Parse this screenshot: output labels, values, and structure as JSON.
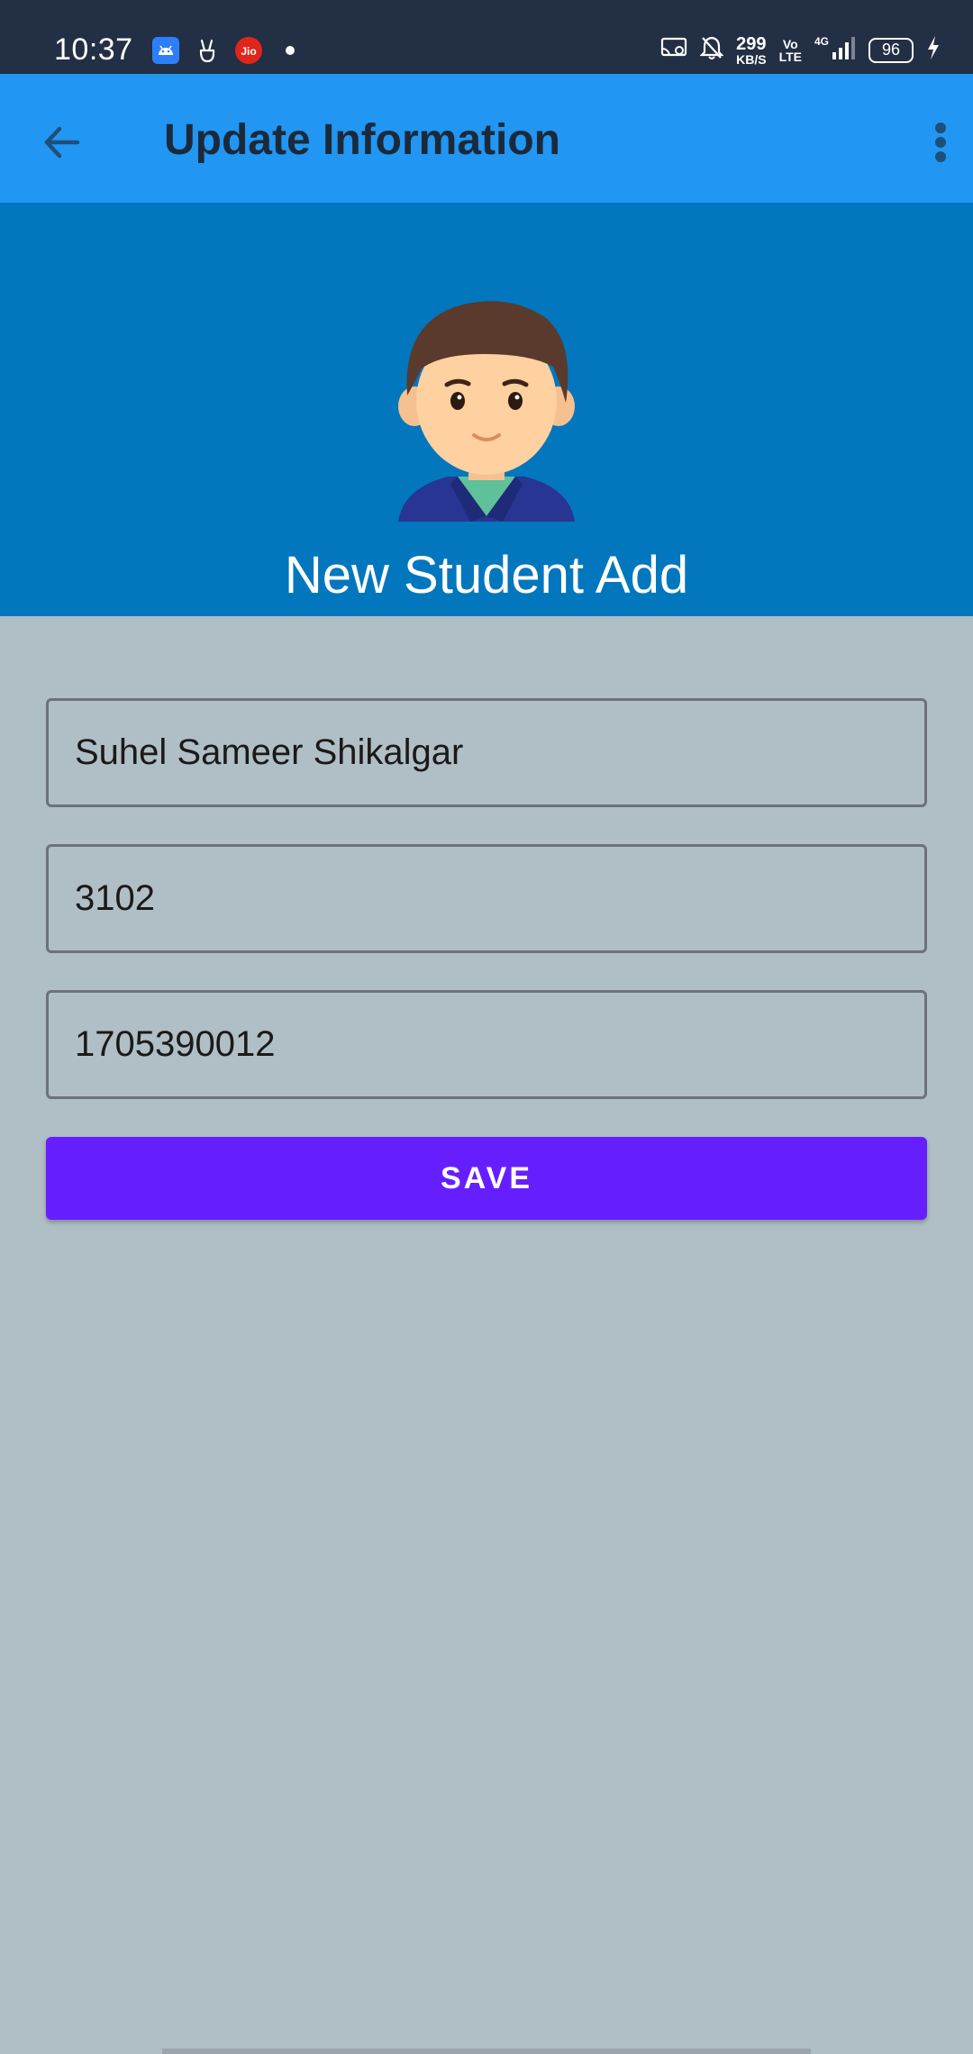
{
  "status_bar": {
    "time": "10:37",
    "notification_icons": [
      "android-icon",
      "peace-hand-icon",
      "jio-icon",
      "dot-icon"
    ],
    "jio_label": "Jio",
    "net_speed_value": "299",
    "net_speed_unit": "KB/S",
    "volte_top": "Vo",
    "volte_bottom": "LTE",
    "network_type": "4G",
    "battery_level": "96",
    "colors": {
      "background": "#232f45",
      "text": "#ffffff"
    }
  },
  "app_bar": {
    "title": "Update Information",
    "colors": {
      "background": "#2196f3",
      "title": "#1b2a3a"
    }
  },
  "banner": {
    "title": "New Student Add",
    "avatar_icon": "student-avatar-icon",
    "colors": {
      "background": "#0277bd"
    }
  },
  "form": {
    "name_value": "Suhel Sameer Shikalgar",
    "roll_value": "3102",
    "phone_value": "1705390012",
    "save_label": "SAVE",
    "colors": {
      "background": "#b0bec5",
      "button": "#651fff",
      "field_border": "#6b7378"
    }
  }
}
